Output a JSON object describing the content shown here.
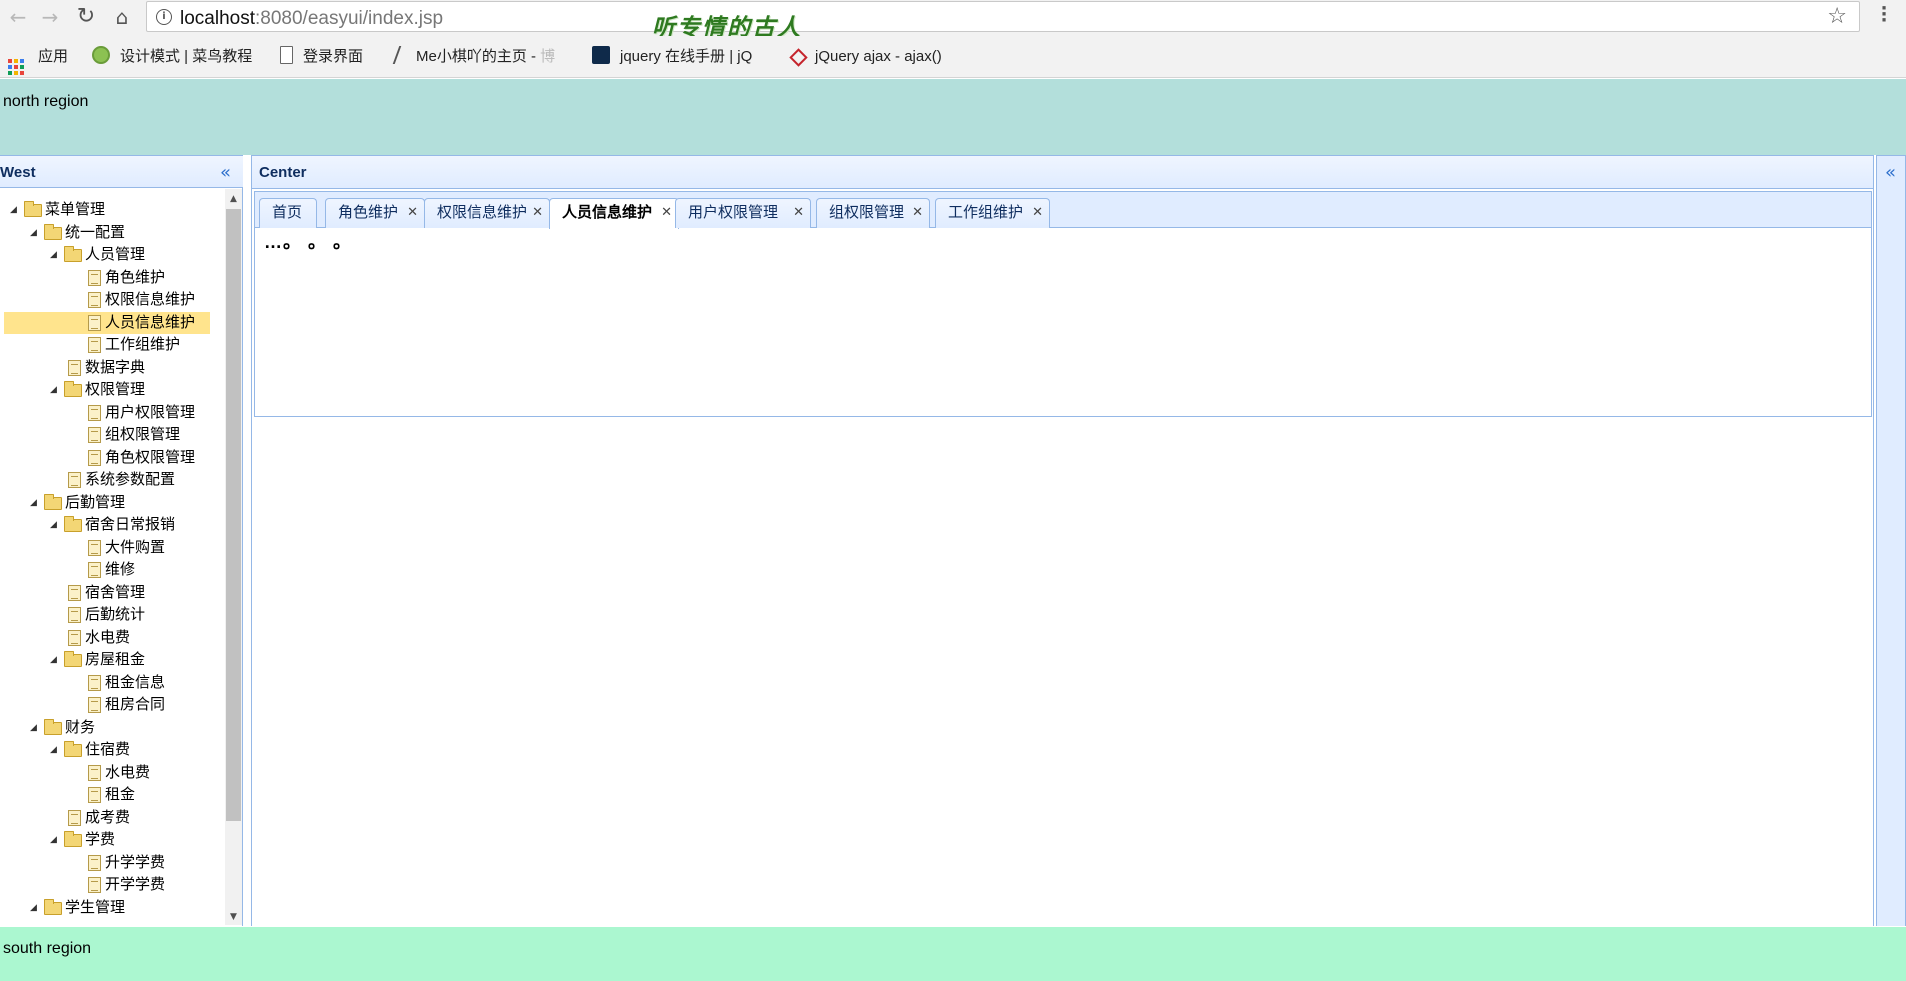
{
  "browser": {
    "url_host": "localhost",
    "url_rest": ":8080/easyui/index.jsp",
    "watermark": "听专情的古人",
    "bookmarks": [
      {
        "label": "应用",
        "icon": "apps-grid-icon"
      },
      {
        "label": "设计模式 | 菜鸟教程",
        "icon": "runoob-icon"
      },
      {
        "label": "登录界面",
        "icon": "page-icon"
      },
      {
        "label": "Me小棋吖的主页 - ",
        "fade": "博",
        "icon": "feather-icon"
      },
      {
        "label": "jquery 在线手册 | jQ",
        "fade": "",
        "icon": "jquery-icon"
      },
      {
        "label": "jQuery ajax - ajax()",
        "fade": "",
        "icon": "w3school-icon"
      }
    ]
  },
  "layout": {
    "north": "north region",
    "south": "south region",
    "west_title": "West",
    "center_title": "Center"
  },
  "tabs": [
    {
      "label": "首页",
      "closable": false
    },
    {
      "label": "角色维护",
      "closable": true
    },
    {
      "label": "权限信息维护",
      "closable": true
    },
    {
      "label": "人员信息维护",
      "closable": true,
      "active": true
    },
    {
      "label": "用户权限管理",
      "closable": true
    },
    {
      "label": "组权限管理",
      "closable": true
    },
    {
      "label": "工作组维护",
      "closable": true
    }
  ],
  "tab_content": "…。 。 。",
  "tree": [
    {
      "label": "菜单管理",
      "depth": 0,
      "type": "folder"
    },
    {
      "label": "统一配置",
      "depth": 1,
      "type": "folder"
    },
    {
      "label": "人员管理",
      "depth": 2,
      "type": "folder"
    },
    {
      "label": "角色维护",
      "depth": 3,
      "type": "file"
    },
    {
      "label": "权限信息维护",
      "depth": 3,
      "type": "file"
    },
    {
      "label": "人员信息维护",
      "depth": 3,
      "type": "file",
      "selected": true
    },
    {
      "label": "工作组维护",
      "depth": 3,
      "type": "file"
    },
    {
      "label": "数据字典",
      "depth": 2,
      "type": "file"
    },
    {
      "label": "权限管理",
      "depth": 2,
      "type": "folder"
    },
    {
      "label": "用户权限管理",
      "depth": 3,
      "type": "file"
    },
    {
      "label": "组权限管理",
      "depth": 3,
      "type": "file"
    },
    {
      "label": "角色权限管理",
      "depth": 3,
      "type": "file"
    },
    {
      "label": "系统参数配置",
      "depth": 2,
      "type": "file"
    },
    {
      "label": "后勤管理",
      "depth": 1,
      "type": "folder"
    },
    {
      "label": "宿舍日常报销",
      "depth": 2,
      "type": "folder"
    },
    {
      "label": "大件购置",
      "depth": 3,
      "type": "file"
    },
    {
      "label": "维修",
      "depth": 3,
      "type": "file"
    },
    {
      "label": "宿舍管理",
      "depth": 2,
      "type": "file"
    },
    {
      "label": "后勤统计",
      "depth": 2,
      "type": "file"
    },
    {
      "label": "水电费",
      "depth": 2,
      "type": "file"
    },
    {
      "label": "房屋租金",
      "depth": 2,
      "type": "folder"
    },
    {
      "label": "租金信息",
      "depth": 3,
      "type": "file"
    },
    {
      "label": "租房合同",
      "depth": 3,
      "type": "file"
    },
    {
      "label": "财务",
      "depth": 1,
      "type": "folder"
    },
    {
      "label": "住宿费",
      "depth": 2,
      "type": "folder"
    },
    {
      "label": "水电费",
      "depth": 3,
      "type": "file"
    },
    {
      "label": "租金",
      "depth": 3,
      "type": "file"
    },
    {
      "label": "成考费",
      "depth": 2,
      "type": "file"
    },
    {
      "label": "学费",
      "depth": 2,
      "type": "folder"
    },
    {
      "label": "升学学费",
      "depth": 3,
      "type": "file"
    },
    {
      "label": "开学学费",
      "depth": 3,
      "type": "file"
    },
    {
      "label": "学生管理",
      "depth": 1,
      "type": "folder"
    }
  ],
  "colors": {
    "north_bg": "#b3dfdb",
    "south_bg": "#abf7d0",
    "selected_bg": "#ffe48d",
    "panel_border": "#95b8e7"
  }
}
